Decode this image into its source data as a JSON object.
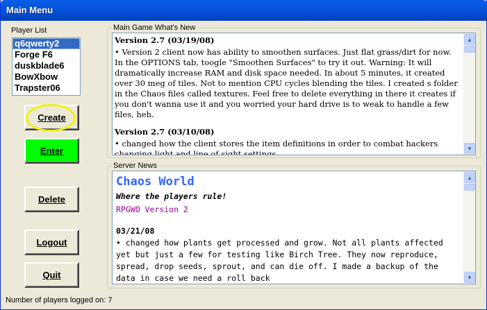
{
  "window": {
    "title": "Main Menu"
  },
  "players": {
    "label": "Player List",
    "items": [
      "q6qwerty2",
      "Forge F6",
      "duskblade6",
      "BowXbow",
      "Trapster06"
    ]
  },
  "buttons": {
    "create": "Create",
    "enter": "Enter",
    "delete": "Delete",
    "logout": "Logout",
    "quit": "Quit"
  },
  "whats_new": {
    "label": "Main Game What's New",
    "entries": [
      {
        "heading": "Version 2.7 (03/19/08)",
        "bullet": "• Version 2 client now has ability to smoothen surfaces. Just flat grass/dirt for now. In the OPTIONS tab, toogle \"Smoothen Surfaces\" to try it out. Warning: It will dramatically increase RAM and disk space needed. In about 5 minutes, it created over 30 meg of tiles. Not to mention CPU cycles blending the tiles. I created s folder in the Chaos files called textures. Feel free to delete everything in there it creates if you don't wanna use it and you worried your hard drive is to weak to handle a few files, heh."
      },
      {
        "heading": "Version 2.7 (03/10/08)",
        "bullet": "• changed how the client stores the item definitions in order to combat hackers changing light and line of sight settings"
      }
    ]
  },
  "server_news": {
    "label": "Server News",
    "title": "Chaos World",
    "tagline": "Where the players rule!",
    "version": "RPGWO Version 2",
    "date": "03/21/08",
    "body": "• changed how plants get processed and grow. Not all plants affected yet but just a few for testing like Birch Tree. They now reproduce, spread, drop seeds, sprout, and can die off. I made a backup of the data in case we need a roll back"
  },
  "status": {
    "text": "Number of players logged on: 7"
  },
  "colors": {
    "title_bar": "#0450d6",
    "enter_button": "#00ff00",
    "highlight_ring": "#f2f20c",
    "server_title": "#3366ff",
    "version_text": "#990099"
  }
}
